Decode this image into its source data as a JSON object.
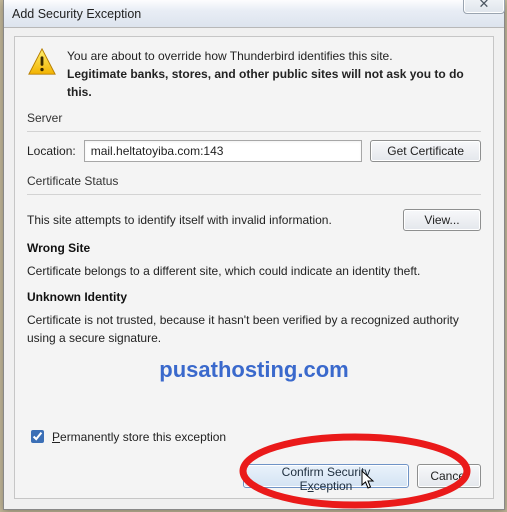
{
  "title": "Add Security Exception",
  "warning_line1": "You are about to override how Thunderbird identifies this site.",
  "warning_line2": "Legitimate banks, stores, and other public sites will not ask you to do this.",
  "server_label": "Server",
  "location_label": "Location:",
  "location_value": "mail.heltatoyiba.com:143",
  "get_cert_btn": "Get Certificate",
  "cert_status_label": "Certificate Status",
  "status_text": "This site attempts to identify itself with invalid information.",
  "view_btn": "View...",
  "wrong_site_head": "Wrong Site",
  "wrong_site_text": "Certificate belongs to a different site, which could indicate an identity theft.",
  "unknown_head": "Unknown Identity",
  "unknown_text": "Certificate is not trusted, because it hasn't been verified by a recognized authority using a secure signature.",
  "watermark": "pusathosting.com",
  "perm_checkbox_prefix_underlined": "P",
  "perm_checkbox_rest": "ermanently store this exception",
  "confirm_btn_prefix": "Confirm Security E",
  "confirm_btn_ul": "x",
  "confirm_btn_suffix": "ception",
  "cancel_btn": "Cancel",
  "perm_checked": true
}
